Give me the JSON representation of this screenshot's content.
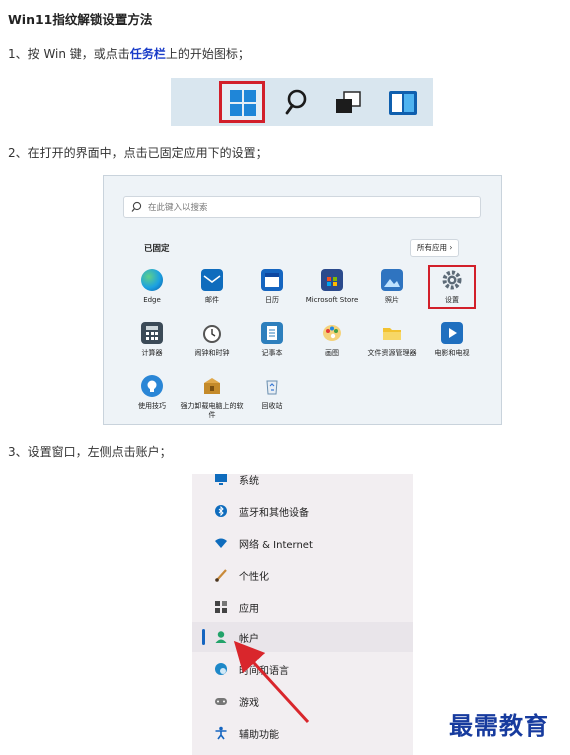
{
  "title": "Win11指纹解锁设置方法",
  "step1": {
    "before": "1、按 Win 键，或点击",
    "highlight": "任务栏",
    "after": "上的开始图标；"
  },
  "step2": "2、在打开的界面中，点击已固定应用下的设置；",
  "step3": "3、设置窗口，左侧点击账户；",
  "start_menu": {
    "search_placeholder": "在此键入以搜索",
    "pinned_label": "已固定",
    "all_apps_label": "所有应用",
    "apps": [
      {
        "label": "Edge",
        "icon": "edge-icon",
        "color": "#1a8fd4"
      },
      {
        "label": "邮件",
        "icon": "mail-icon",
        "color": "#0f6cbd"
      },
      {
        "label": "日历",
        "icon": "calendar-icon",
        "color": "#1565c0"
      },
      {
        "label": "Microsoft Store",
        "icon": "store-icon",
        "color": "#2b4a8c"
      },
      {
        "label": "照片",
        "icon": "photos-icon",
        "color": "#2f74c0"
      },
      {
        "label": "设置",
        "icon": "gear-icon",
        "color": "#5d6b78"
      },
      {
        "label": "计算器",
        "icon": "calculator-icon",
        "color": "#3b4a57"
      },
      {
        "label": "闹钟和时钟",
        "icon": "clock-icon",
        "color": "#6b7782"
      },
      {
        "label": "记事本",
        "icon": "notepad-icon",
        "color": "#2d7fbd"
      },
      {
        "label": "画图",
        "icon": "paint-icon",
        "color": "#e0a030"
      },
      {
        "label": "文件资源管理器",
        "icon": "folder-icon",
        "color": "#f2c230"
      },
      {
        "label": "电影和电视",
        "icon": "movies-icon",
        "color": "#1f6fbf"
      },
      {
        "label": "使用技巧",
        "icon": "tips-icon",
        "color": "#2a86d6"
      },
      {
        "label": "强力卸载电脑上的软件",
        "icon": "uninstall-icon",
        "color": "#c48a2a"
      },
      {
        "label": "回收站",
        "icon": "recycle-bin-icon",
        "color": "#6a8fb0"
      }
    ]
  },
  "settings_nav": [
    {
      "label": "系统",
      "icon": "system-icon",
      "color": "#0f6cbd"
    },
    {
      "label": "蓝牙和其他设备",
      "icon": "bluetooth-icon",
      "color": "#0f6cbd"
    },
    {
      "label": "网络 & Internet",
      "icon": "wifi-icon",
      "color": "#0f6cbd"
    },
    {
      "label": "个性化",
      "icon": "brush-icon",
      "color": "#c98a3a"
    },
    {
      "label": "应用",
      "icon": "apps-icon",
      "color": "#444"
    },
    {
      "label": "帐户",
      "icon": "account-icon",
      "color": "#22a36a",
      "active": true
    },
    {
      "label": "时间和语言",
      "icon": "globe-clock-icon",
      "color": "#1e88c8"
    },
    {
      "label": "游戏",
      "icon": "gamepad-icon",
      "color": "#666"
    },
    {
      "label": "辅助功能",
      "icon": "accessibility-icon",
      "color": "#1565c0"
    }
  ],
  "watermark": "最需教育",
  "accent_colors": {
    "highlight_frame": "#d21f2a",
    "link": "#1a3cc8",
    "arrow": "#d9262c"
  }
}
